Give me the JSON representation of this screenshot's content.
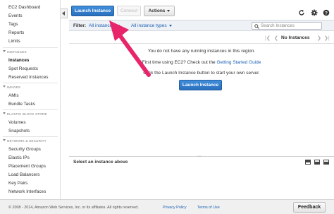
{
  "sidebar": {
    "items_top": [
      "EC2 Dashboard",
      "Events",
      "Tags",
      "Reports",
      "Limits"
    ],
    "sections": [
      {
        "title": "INSTANCES",
        "items": [
          "Instances",
          "Spot Requests",
          "Reserved Instances"
        ],
        "active": "Instances"
      },
      {
        "title": "IMAGES",
        "items": [
          "AMIs",
          "Bundle Tasks"
        ]
      },
      {
        "title": "ELASTIC BLOCK STORE",
        "items": [
          "Volumes",
          "Snapshots"
        ]
      },
      {
        "title": "NETWORK & SECURITY",
        "items": [
          "Security Groups",
          "Elastic IPs",
          "Placement Groups",
          "Load Balancers",
          "Key Pairs",
          "Network Interfaces"
        ]
      }
    ]
  },
  "toolbar": {
    "launch_label": "Launch Instance",
    "connect_label": "Connect",
    "actions_label": "Actions"
  },
  "filter": {
    "label": "Filter:",
    "state_option": "All instances",
    "type_option": "All instance types",
    "search_placeholder": "Search Instances"
  },
  "pager": {
    "text": "No Instances"
  },
  "empty": {
    "line1": "You do not have any running instances in this region.",
    "line2_prefix": "First time using EC2? Check out the",
    "line2_link": "Getting Started Guide",
    "line3": "Click the Launch Instance button to start your own server.",
    "button_label": "Launch Instance"
  },
  "detail": {
    "label": "Select an instance above"
  },
  "footer": {
    "copyright": "© 2008 - 2014, Amazon Web Services, Inc. or its affiliates. All rights reserved.",
    "privacy": "Privacy Policy",
    "terms": "Terms of Use",
    "feedback": "Feedback"
  },
  "colors": {
    "primary_button": "#2a6fbd",
    "link": "#1a5fb4",
    "annotation_arrow": "#e8246a"
  }
}
